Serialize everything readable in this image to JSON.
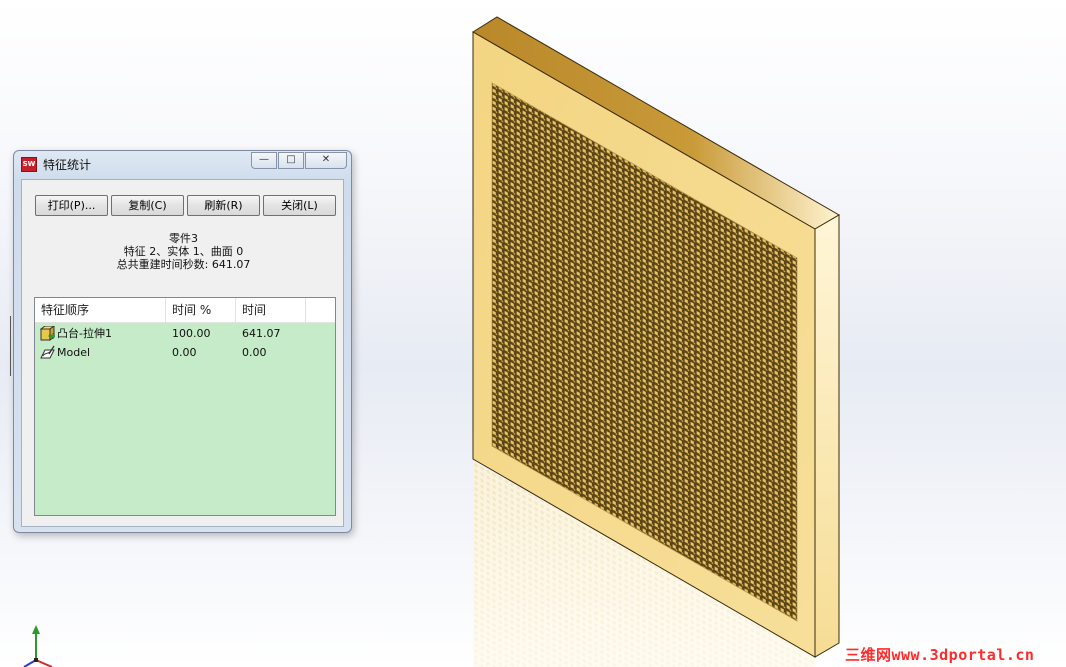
{
  "dialog": {
    "title": "特征统计",
    "app_icon_label": "SW",
    "caption": {
      "minimize": "—",
      "maximize": "□",
      "close": "✕"
    },
    "buttons": {
      "print": "打印(P)...",
      "copy": "复制(C)",
      "refresh": "刷新(R)",
      "close": "关闭(L)"
    },
    "summary": {
      "part_name": "零件3",
      "counts": "特征 2、实体 1、曲面 0",
      "rebuild_time": "总共重建时间秒数: 641.07"
    },
    "table": {
      "headers": [
        "特征顺序",
        "时间 %",
        "时间",
        ""
      ],
      "rows": [
        {
          "icon": "boss-extrude-icon",
          "name": "凸台-拉伸1",
          "percent": "100.00",
          "time": "641.07"
        },
        {
          "icon": "sketch-icon",
          "name": "Model",
          "percent": "0.00",
          "time": "0.00"
        }
      ]
    }
  },
  "colors": {
    "table_background": "#c5ebc8",
    "model_gold": "#e2b94c",
    "watermark": "#ff2a2a"
  },
  "watermark": "三维网www.3dportal.cn"
}
